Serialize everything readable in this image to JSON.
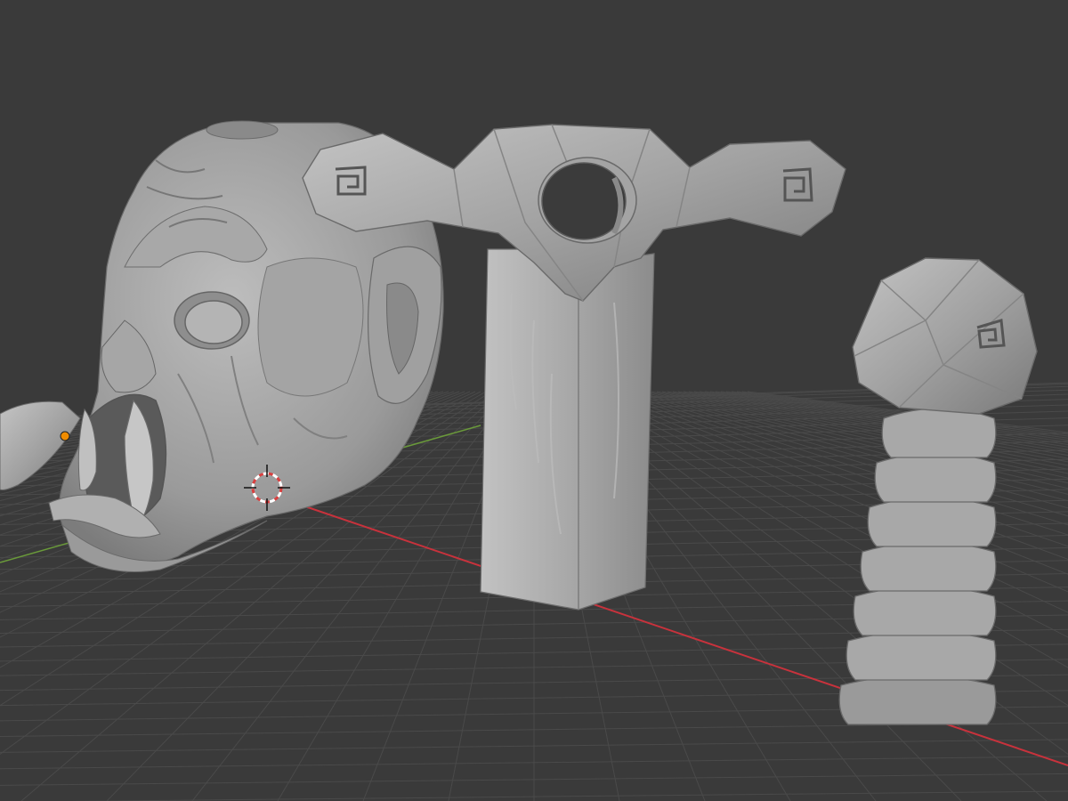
{
  "app": {
    "name": "3D viewport",
    "mode": "sculpt"
  },
  "viewport": {
    "background_color": "#3a3a3a",
    "grid_color": "#4a4a4a"
  },
  "axes": {
    "x_axis_color": "#c8323c",
    "y_axis_color": "#6a9a3a"
  },
  "objects": [
    {
      "name": "orc-head",
      "material_color": "#9a9a9a"
    },
    {
      "name": "sword-hilt-crossguard",
      "material_color": "#9e9e9e"
    },
    {
      "name": "sword-hilt-grip",
      "material_color": "#a2a2a2"
    },
    {
      "name": "sword-pommel-and-wrapped-handle",
      "material_color": "#9c9c9c"
    }
  ],
  "overlays": {
    "origin_point_color": "#f08c00",
    "cursor_color": "#d84040",
    "icons": [
      "3d-cursor-icon",
      "object-origin-icon"
    ]
  }
}
